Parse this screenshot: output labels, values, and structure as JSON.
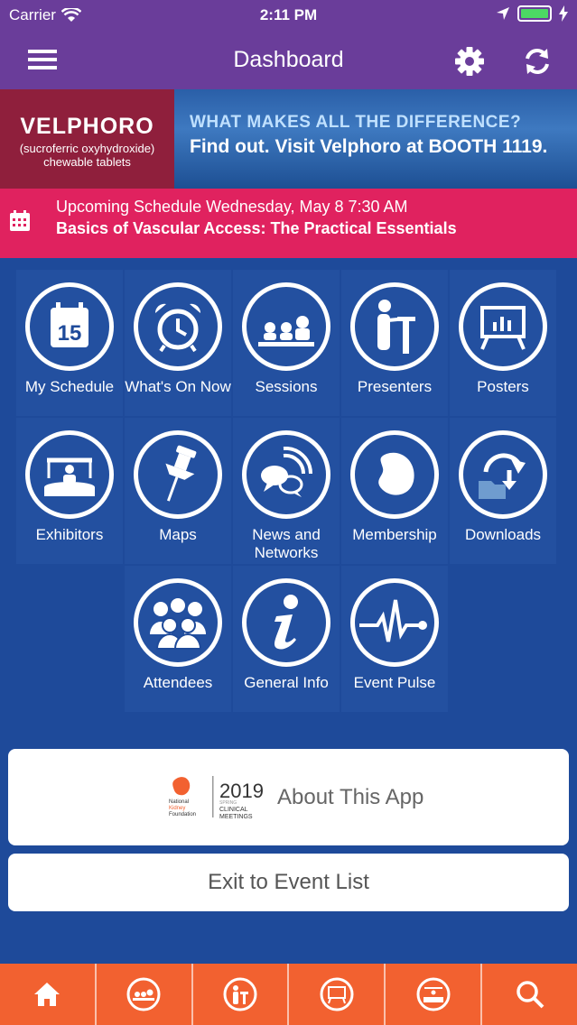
{
  "status": {
    "carrier": "Carrier",
    "time": "2:11 PM",
    "battery_level": 1.0
  },
  "nav": {
    "title": "Dashboard"
  },
  "ad": {
    "brand": "VELPHORO",
    "brand_sub": "(sucroferric oxyhydroxide) chewable tablets",
    "line1": "WHAT MAKES ALL THE DIFFERENCE?",
    "line2": "Find out. Visit Velphoro at BOOTH 1119."
  },
  "upcoming": {
    "line1": "Upcoming Schedule Wednesday, May 8 7:30 AM",
    "line2": "Basics of Vascular Access: The Practical Essentials"
  },
  "tiles": [
    {
      "label": "My Schedule",
      "icon": "calendar-15-icon"
    },
    {
      "label": "What's On Now",
      "icon": "alarm-clock-icon"
    },
    {
      "label": "Sessions",
      "icon": "audience-icon"
    },
    {
      "label": "Presenters",
      "icon": "presenter-podium-icon"
    },
    {
      "label": "Posters",
      "icon": "poster-board-icon"
    },
    {
      "label": "Exhibitors",
      "icon": "exhibitor-booth-icon"
    },
    {
      "label": "Maps",
      "icon": "pushpin-icon"
    },
    {
      "label": "News and Networks",
      "icon": "chat-signal-icon"
    },
    {
      "label": "Membership",
      "icon": "kidney-icon"
    },
    {
      "label": "Downloads",
      "icon": "download-folder-icon"
    },
    {
      "label": "Attendees",
      "icon": "people-group-icon"
    },
    {
      "label": "General Info",
      "icon": "info-icon"
    },
    {
      "label": "Event Pulse",
      "icon": "pulse-icon"
    }
  ],
  "about": {
    "label": "About This App",
    "logo_year": "2019",
    "logo_org": "National Kidney Foundation",
    "logo_tag": "SPRING CLINICAL MEETINGS",
    "logo_top": "SPRING"
  },
  "exit": {
    "label": "Exit to Event List"
  },
  "tabbar": {
    "tabs": [
      "home-icon",
      "sessions-icon",
      "presenters-icon",
      "posters-icon",
      "exhibitors-icon",
      "search-icon"
    ]
  },
  "colors": {
    "nav": "#6a3d9a",
    "accent": "#e0225f",
    "tabbar": "#f26130",
    "background": "#1e4a9a"
  }
}
